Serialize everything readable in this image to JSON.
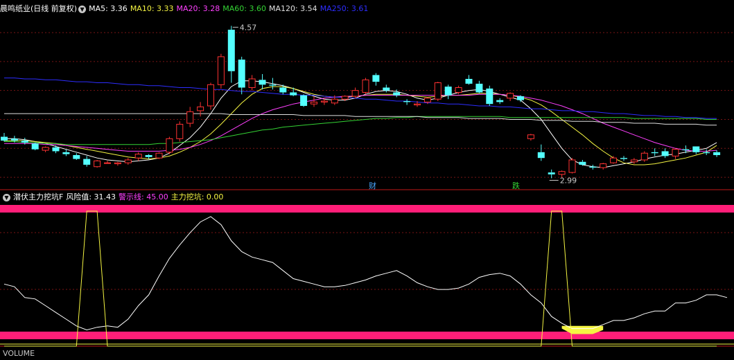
{
  "main_panel": {
    "title": "晨鸣纸业(日线 前复权)",
    "indicators": [
      {
        "label": "MA5:",
        "value": "3.36",
        "color": "#ffffff"
      },
      {
        "label": "MA10:",
        "value": "3.33",
        "color": "#f5f542"
      },
      {
        "label": "MA20:",
        "value": "3.28",
        "color": "#ff40ff"
      },
      {
        "label": "MA60:",
        "value": "3.60",
        "color": "#34d334"
      },
      {
        "label": "MA120:",
        "value": "3.54",
        "color": "#e0e0e0"
      },
      {
        "label": "MA250:",
        "value": "3.61",
        "color": "#2d2dff"
      }
    ],
    "high_label": "4.57",
    "low_label": "2.99",
    "event_badges": [
      {
        "text": "财",
        "color": "#4aa8ff"
      },
      {
        "text": "跌",
        "color": "#34d334"
      }
    ]
  },
  "sub_panel": {
    "title": "潜伏主力挖坑F",
    "indicators": [
      {
        "label": "风险值:",
        "value": "31.43",
        "color": "#ffffff"
      },
      {
        "label": "警示线:",
        "value": "45.00",
        "color": "#ff40ff"
      },
      {
        "label": "主力挖坑:",
        "value": "0.00",
        "color": "#f5f542"
      }
    ]
  },
  "footer_fragment": "VOLUME",
  "colors": {
    "background": "#000000",
    "up": "#ff3232",
    "down": "#54ffff",
    "grid": "#7a1515",
    "divider": "#c01818",
    "band": "#ff1e78",
    "ma5": "#ffffff",
    "ma10": "#f5f542",
    "ma20": "#ff40ff",
    "ma60": "#34d334",
    "ma120": "#e0e0e0",
    "ma250": "#2d2dff",
    "risk": "#ffffff",
    "pit": "#f5f542"
  },
  "chart_data": [
    {
      "type": "candlestick",
      "title": "晨鸣纸业(日线 前复权)",
      "ylim": [
        2.9,
        4.68
      ],
      "candles": [
        [
          3.42,
          3.46,
          3.37,
          3.38
        ],
        [
          3.4,
          3.43,
          3.36,
          3.38
        ],
        [
          3.38,
          3.41,
          3.34,
          3.36
        ],
        [
          3.35,
          3.36,
          3.28,
          3.29
        ],
        [
          3.28,
          3.32,
          3.26,
          3.31
        ],
        [
          3.31,
          3.33,
          3.25,
          3.27
        ],
        [
          3.26,
          3.29,
          3.22,
          3.24
        ],
        [
          3.23,
          3.25,
          3.18,
          3.19
        ],
        [
          3.19,
          3.22,
          3.11,
          3.13
        ],
        [
          3.11,
          3.18,
          3.1,
          3.17
        ],
        [
          3.15,
          3.17,
          3.14,
          3.15
        ],
        [
          3.14,
          3.16,
          3.12,
          3.15
        ],
        [
          3.15,
          3.2,
          3.13,
          3.18
        ],
        [
          3.2,
          3.26,
          3.17,
          3.24
        ],
        [
          3.23,
          3.24,
          3.19,
          3.21
        ],
        [
          3.2,
          3.26,
          3.19,
          3.25
        ],
        [
          3.26,
          3.42,
          3.24,
          3.4
        ],
        [
          3.4,
          3.58,
          3.37,
          3.55
        ],
        [
          3.56,
          3.73,
          3.52,
          3.68
        ],
        [
          3.69,
          3.78,
          3.63,
          3.73
        ],
        [
          3.74,
          3.98,
          3.7,
          3.96
        ],
        [
          3.96,
          4.28,
          3.92,
          4.25
        ],
        [
          4.53,
          4.57,
          3.98,
          4.1
        ],
        [
          4.22,
          4.25,
          3.86,
          3.93
        ],
        [
          3.93,
          4.06,
          3.9,
          4.02
        ],
        [
          4.01,
          4.07,
          3.91,
          3.96
        ],
        [
          3.96,
          4.03,
          3.91,
          3.95
        ],
        [
          3.93,
          3.96,
          3.86,
          3.88
        ],
        [
          3.88,
          3.93,
          3.84,
          3.85
        ],
        [
          3.85,
          3.86,
          3.73,
          3.74
        ],
        [
          3.76,
          3.84,
          3.73,
          3.78
        ],
        [
          3.78,
          3.82,
          3.75,
          3.79
        ],
        [
          3.77,
          3.85,
          3.75,
          3.81
        ],
        [
          3.81,
          3.85,
          3.79,
          3.84
        ],
        [
          3.84,
          3.93,
          3.82,
          3.9
        ],
        [
          3.88,
          4.03,
          3.86,
          4.01
        ],
        [
          4.06,
          4.08,
          3.95,
          3.99
        ],
        [
          3.93,
          3.96,
          3.88,
          3.9
        ],
        [
          3.88,
          3.91,
          3.83,
          3.85
        ],
        [
          3.79,
          3.81,
          3.75,
          3.78
        ],
        [
          3.75,
          3.79,
          3.73,
          3.76
        ],
        [
          3.78,
          3.83,
          3.76,
          3.82
        ],
        [
          3.81,
          3.99,
          3.79,
          3.98
        ],
        [
          3.94,
          3.96,
          3.81,
          3.85
        ],
        [
          3.88,
          3.95,
          3.86,
          3.93
        ],
        [
          4.02,
          4.06,
          3.96,
          3.97
        ],
        [
          3.97,
          4.0,
          3.87,
          3.88
        ],
        [
          3.92,
          3.95,
          3.74,
          3.76
        ],
        [
          3.8,
          3.82,
          3.76,
          3.78
        ],
        [
          3.82,
          3.88,
          3.79,
          3.87
        ],
        [
          3.84,
          3.85,
          3.78,
          3.8
        ],
        [
          3.4,
          3.45,
          3.38,
          3.44
        ],
        [
          3.26,
          3.34,
          3.17,
          3.2
        ],
        [
          3.05,
          3.08,
          2.99,
          3.03
        ],
        [
          3.03,
          3.07,
          3.0,
          3.06
        ],
        [
          3.05,
          3.2,
          3.04,
          3.18
        ],
        [
          3.16,
          3.18,
          3.12,
          3.13
        ],
        [
          3.11,
          3.13,
          3.08,
          3.1
        ],
        [
          3.1,
          3.15,
          3.08,
          3.14
        ],
        [
          3.15,
          3.22,
          3.14,
          3.2
        ],
        [
          3.2,
          3.22,
          3.17,
          3.19
        ],
        [
          3.16,
          3.2,
          3.14,
          3.18
        ],
        [
          3.18,
          3.27,
          3.16,
          3.25
        ],
        [
          3.26,
          3.3,
          3.22,
          3.25
        ],
        [
          3.27,
          3.3,
          3.2,
          3.22
        ],
        [
          3.22,
          3.3,
          3.19,
          3.29
        ],
        [
          3.29,
          3.33,
          3.25,
          3.28
        ],
        [
          3.32,
          3.32,
          3.24,
          3.26
        ],
        [
          3.26,
          3.29,
          3.23,
          3.25
        ],
        [
          3.26,
          3.28,
          3.21,
          3.23
        ]
      ],
      "ma_series": [
        {
          "name": "MA5",
          "values": [
            3.4,
            3.4,
            3.39,
            3.37,
            3.35,
            3.32,
            3.29,
            3.26,
            3.23,
            3.2,
            3.18,
            3.17,
            3.16,
            3.17,
            3.18,
            3.2,
            3.25,
            3.33,
            3.41,
            3.52,
            3.66,
            3.82,
            3.94,
            4.0,
            4.0,
            3.99,
            3.97,
            3.95,
            3.92,
            3.88,
            3.84,
            3.81,
            3.8,
            3.8,
            3.82,
            3.86,
            3.89,
            3.9,
            3.89,
            3.86,
            3.82,
            3.8,
            3.82,
            3.85,
            3.88,
            3.9,
            3.91,
            3.89,
            3.86,
            3.83,
            3.8,
            3.71,
            3.6,
            3.45,
            3.3,
            3.18,
            3.13,
            3.11,
            3.1,
            3.12,
            3.14,
            3.16,
            3.19,
            3.21,
            3.23,
            3.24,
            3.26,
            3.28,
            3.3,
            3.36
          ]
        },
        {
          "name": "MA10",
          "values": [
            3.38,
            3.38,
            3.38,
            3.37,
            3.36,
            3.35,
            3.33,
            3.31,
            3.29,
            3.27,
            3.25,
            3.23,
            3.21,
            3.2,
            3.19,
            3.2,
            3.22,
            3.26,
            3.31,
            3.37,
            3.45,
            3.55,
            3.66,
            3.77,
            3.86,
            3.92,
            3.94,
            3.94,
            3.92,
            3.89,
            3.86,
            3.84,
            3.83,
            3.83,
            3.84,
            3.85,
            3.86,
            3.86,
            3.86,
            3.85,
            3.84,
            3.83,
            3.84,
            3.85,
            3.85,
            3.86,
            3.87,
            3.87,
            3.86,
            3.85,
            3.83,
            3.8,
            3.75,
            3.68,
            3.6,
            3.52,
            3.44,
            3.35,
            3.27,
            3.2,
            3.15,
            3.13,
            3.13,
            3.14,
            3.16,
            3.18,
            3.2,
            3.23,
            3.26,
            3.33
          ]
        },
        {
          "name": "MA20",
          "values": [
            3.35,
            3.35,
            3.35,
            3.35,
            3.34,
            3.34,
            3.33,
            3.32,
            3.31,
            3.3,
            3.29,
            3.28,
            3.27,
            3.27,
            3.27,
            3.27,
            3.28,
            3.29,
            3.31,
            3.34,
            3.38,
            3.43,
            3.49,
            3.55,
            3.61,
            3.66,
            3.7,
            3.73,
            3.76,
            3.78,
            3.8,
            3.82,
            3.83,
            3.84,
            3.84,
            3.85,
            3.85,
            3.85,
            3.85,
            3.85,
            3.85,
            3.85,
            3.85,
            3.85,
            3.85,
            3.85,
            3.86,
            3.86,
            3.86,
            3.85,
            3.84,
            3.82,
            3.8,
            3.77,
            3.74,
            3.7,
            3.66,
            3.61,
            3.56,
            3.52,
            3.48,
            3.44,
            3.4,
            3.36,
            3.33,
            3.3,
            3.28,
            3.27,
            3.27,
            3.28
          ]
        },
        {
          "name": "MA60",
          "values": [
            3.37,
            3.37,
            3.36,
            3.36,
            3.35,
            3.35,
            3.34,
            3.34,
            3.34,
            3.34,
            3.34,
            3.34,
            3.34,
            3.34,
            3.34,
            3.35,
            3.35,
            3.36,
            3.37,
            3.38,
            3.39,
            3.41,
            3.43,
            3.45,
            3.47,
            3.49,
            3.5,
            3.52,
            3.53,
            3.54,
            3.55,
            3.56,
            3.57,
            3.58,
            3.59,
            3.6,
            3.61,
            3.61,
            3.62,
            3.62,
            3.63,
            3.63,
            3.63,
            3.63,
            3.63,
            3.63,
            3.63,
            3.63,
            3.63,
            3.62,
            3.62,
            3.62,
            3.62,
            3.62,
            3.62,
            3.62,
            3.62,
            3.62,
            3.62,
            3.62,
            3.62,
            3.61,
            3.61,
            3.61,
            3.61,
            3.61,
            3.61,
            3.61,
            3.6,
            3.6
          ]
        },
        {
          "name": "MA120",
          "values": [
            3.66,
            3.66,
            3.66,
            3.66,
            3.66,
            3.66,
            3.66,
            3.66,
            3.66,
            3.66,
            3.66,
            3.66,
            3.66,
            3.66,
            3.66,
            3.66,
            3.66,
            3.66,
            3.66,
            3.66,
            3.66,
            3.66,
            3.65,
            3.65,
            3.65,
            3.65,
            3.65,
            3.65,
            3.65,
            3.64,
            3.64,
            3.64,
            3.64,
            3.64,
            3.63,
            3.63,
            3.63,
            3.63,
            3.63,
            3.63,
            3.63,
            3.62,
            3.62,
            3.62,
            3.62,
            3.61,
            3.61,
            3.61,
            3.61,
            3.6,
            3.6,
            3.6,
            3.59,
            3.59,
            3.59,
            3.58,
            3.58,
            3.58,
            3.57,
            3.57,
            3.57,
            3.56,
            3.56,
            3.56,
            3.55,
            3.55,
            3.55,
            3.55,
            3.54,
            3.54
          ]
        },
        {
          "name": "MA250",
          "values": [
            4.03,
            4.03,
            4.02,
            4.02,
            4.01,
            4.01,
            4.0,
            3.99,
            3.99,
            3.98,
            3.98,
            3.97,
            3.96,
            3.96,
            3.95,
            3.95,
            3.94,
            3.93,
            3.93,
            3.92,
            3.91,
            3.91,
            3.9,
            3.89,
            3.89,
            3.88,
            3.87,
            3.86,
            3.86,
            3.85,
            3.85,
            3.84,
            3.83,
            3.83,
            3.82,
            3.81,
            3.81,
            3.8,
            3.79,
            3.79,
            3.78,
            3.77,
            3.77,
            3.76,
            3.76,
            3.75,
            3.74,
            3.74,
            3.73,
            3.73,
            3.72,
            3.71,
            3.71,
            3.7,
            3.69,
            3.69,
            3.68,
            3.68,
            3.67,
            3.66,
            3.66,
            3.65,
            3.64,
            3.64,
            3.63,
            3.63,
            3.62,
            3.62,
            3.61,
            3.61
          ]
        }
      ]
    },
    {
      "type": "line",
      "title": "潜伏主力挖坑F",
      "ylim": [
        0,
        100
      ],
      "bands": [
        {
          "name": "警示线",
          "value": 45
        }
      ],
      "series": [
        {
          "name": "风险值",
          "values": [
            46,
            44,
            36,
            35,
            30,
            25,
            20,
            15,
            12,
            14,
            15,
            14,
            20,
            30,
            38,
            52,
            65,
            75,
            84,
            92,
            96,
            90,
            78,
            70,
            66,
            64,
            62,
            56,
            50,
            48,
            46,
            44,
            44,
            45,
            47,
            49,
            52,
            54,
            56,
            52,
            47,
            44,
            42,
            42,
            43,
            46,
            51,
            53,
            54,
            52,
            46,
            38,
            32,
            22,
            17,
            13,
            13,
            13,
            16,
            19,
            19,
            21,
            24,
            26,
            26,
            32,
            32,
            34,
            38,
            38,
            36
          ]
        },
        {
          "name": "主力挖坑",
          "values": [
            0,
            0,
            0,
            0,
            0,
            0,
            0,
            0,
            100,
            100,
            0,
            0,
            0,
            0,
            0,
            0,
            0,
            0,
            0,
            0,
            0,
            0,
            0,
            0,
            0,
            0,
            0,
            0,
            0,
            0,
            0,
            0,
            0,
            0,
            0,
            0,
            0,
            0,
            0,
            0,
            0,
            0,
            0,
            0,
            0,
            0,
            0,
            0,
            0,
            0,
            0,
            0,
            0,
            100,
            100,
            0,
            0,
            0,
            0,
            0,
            0,
            0,
            0,
            0,
            0,
            0,
            0,
            0,
            0,
            0
          ]
        }
      ]
    }
  ]
}
